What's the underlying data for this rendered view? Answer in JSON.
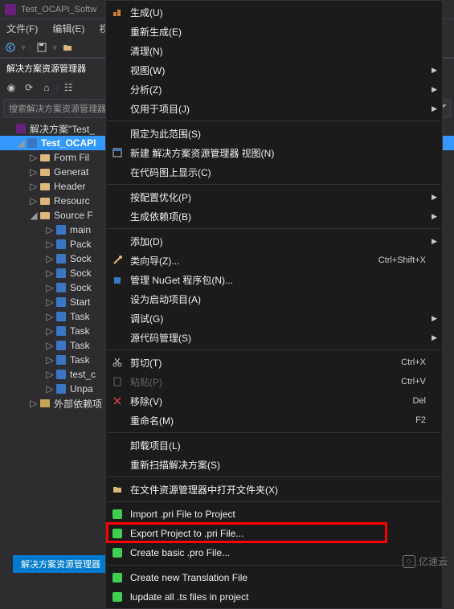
{
  "window": {
    "title": "Test_OCAPI_Softw"
  },
  "menubar": {
    "file": "文件(F)",
    "edit": "编辑(E)",
    "view": "视图"
  },
  "panel": {
    "title": "解决方案资源管理器",
    "search_placeholder": "搜索解决方案资源管理器(Ctrl+;)"
  },
  "tree": {
    "solution": "解决方案\"Test_",
    "project": "Test_OCAPI",
    "items": [
      "Form Fil",
      "Generat",
      "Header",
      "Resourc"
    ],
    "source_folder": "Source F",
    "source_items": [
      "main",
      "Pack",
      "Sock",
      "Sock",
      "Sock",
      "Start",
      "Task",
      "Task",
      "Task",
      "Task",
      "test_c",
      "Unpa"
    ],
    "external": "外部依赖项"
  },
  "context_menu": {
    "items": [
      {
        "label": "生成(U)",
        "icon": "build"
      },
      {
        "label": "重新生成(E)"
      },
      {
        "label": "清理(N)"
      },
      {
        "label": "视图(W)",
        "submenu": true
      },
      {
        "label": "分析(Z)",
        "submenu": true
      },
      {
        "label": "仅用于项目(J)",
        "submenu": true
      },
      {
        "sep": true
      },
      {
        "label": "限定为此范围(S)"
      },
      {
        "label": "新建 解决方案资源管理器 视图(N)",
        "icon": "new-view"
      },
      {
        "label": "在代码图上显示(C)"
      },
      {
        "sep": true
      },
      {
        "label": "按配置优化(P)",
        "submenu": true
      },
      {
        "label": "生成依赖项(B)",
        "submenu": true
      },
      {
        "sep": true
      },
      {
        "label": "添加(D)",
        "submenu": true
      },
      {
        "label": "类向导(Z)...",
        "icon": "wizard",
        "shortcut": "Ctrl+Shift+X"
      },
      {
        "label": "管理 NuGet 程序包(N)...",
        "icon": "nuget"
      },
      {
        "label": "设为启动项目(A)"
      },
      {
        "label": "调试(G)",
        "submenu": true
      },
      {
        "label": "源代码管理(S)",
        "submenu": true
      },
      {
        "sep": true
      },
      {
        "label": "剪切(T)",
        "icon": "cut",
        "shortcut": "Ctrl+X"
      },
      {
        "label": "粘贴(P)",
        "icon": "paste",
        "shortcut": "Ctrl+V",
        "disabled": true
      },
      {
        "label": "移除(V)",
        "icon": "remove",
        "shortcut": "Del"
      },
      {
        "label": "重命名(M)",
        "shortcut": "F2"
      },
      {
        "sep": true
      },
      {
        "label": "卸载项目(L)"
      },
      {
        "label": "重新扫描解决方案(S)"
      },
      {
        "sep": true
      },
      {
        "label": "在文件资源管理器中打开文件夹(X)",
        "icon": "folder"
      },
      {
        "sep": true
      },
      {
        "label": "Import .pri File to Project",
        "icon": "qt"
      },
      {
        "label": "Export Project to .pri File...",
        "icon": "qt",
        "highlighted": true
      },
      {
        "label": "Create basic .pro File...",
        "icon": "qt"
      },
      {
        "sep": true
      },
      {
        "label": "Create new Translation File",
        "icon": "qt"
      },
      {
        "label": "lupdate all .ts files in project",
        "icon": "qt"
      }
    ]
  },
  "footer": {
    "tab": "解决方案资源管理器"
  },
  "watermark": {
    "text": "亿速云"
  }
}
